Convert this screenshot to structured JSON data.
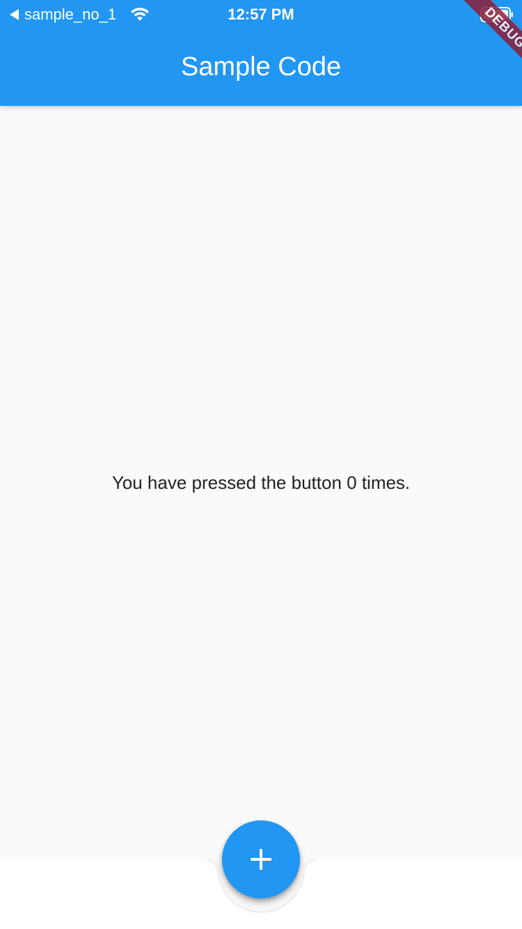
{
  "status_bar": {
    "back_app": "sample_no_1",
    "time": "12:57 PM",
    "icons": [
      "back-triangle-icon",
      "wifi-icon",
      "battery-icon"
    ]
  },
  "app_bar": {
    "title": "Sample Code",
    "color": "#2196f3"
  },
  "debug_banner": {
    "label": "DEBUG",
    "color": "#8a1f3a"
  },
  "body": {
    "message": "You have pressed the button 0 times."
  },
  "fab": {
    "icon": "plus-icon",
    "color": "#2196f3"
  },
  "colors": {
    "background": "#fafafa",
    "bottom_bar": "#ffffff",
    "text": "#222222"
  }
}
